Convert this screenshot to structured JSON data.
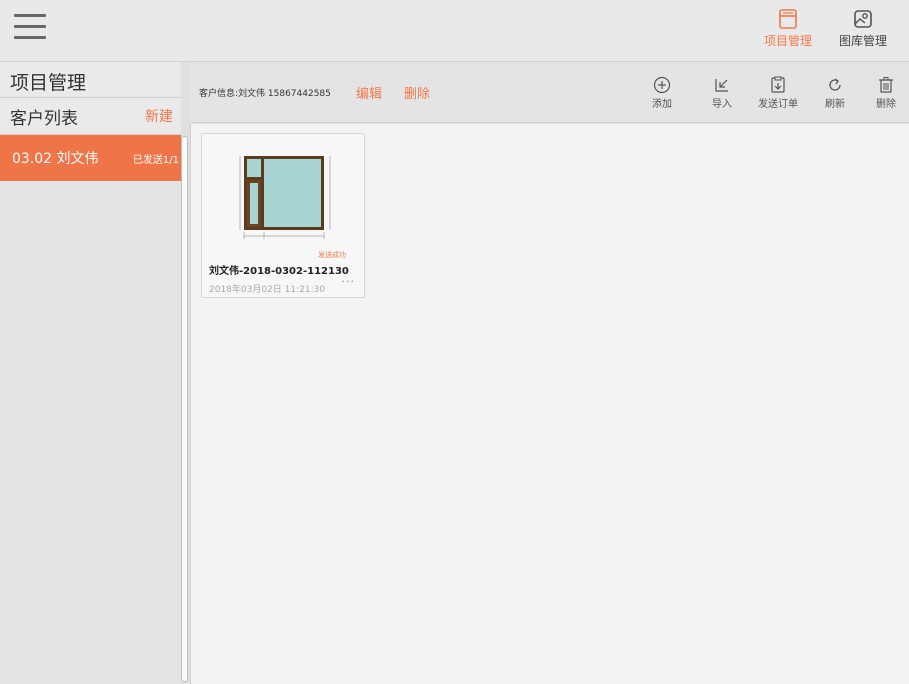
{
  "topbar": {
    "project_label": "项目管理",
    "gallery_label": "图库管理",
    "accent": "#f0784a"
  },
  "sidebar": {
    "title": "项目管理",
    "client_list_label": "客户列表",
    "new_label": "新建",
    "clients": [
      {
        "name": "03.02 刘文伟",
        "status": "已发送1/1"
      }
    ]
  },
  "infobar": {
    "client_info": "客户信息:刘文伟 15867442585",
    "edit_label": "编辑",
    "delete_label": "删除",
    "tools": [
      {
        "icon": "add-circle-icon",
        "label": "添加"
      },
      {
        "icon": "import-icon",
        "label": "导入"
      },
      {
        "icon": "send-order-icon",
        "label": "发送订单"
      },
      {
        "icon": "refresh-icon",
        "label": "刷新"
      },
      {
        "icon": "trash-icon",
        "label": "删除"
      }
    ]
  },
  "projects": [
    {
      "title": "刘文伟-2018-0302-112130",
      "date": "2018年03月02日 11:21:30",
      "status": "发送成功",
      "more": "..."
    }
  ]
}
